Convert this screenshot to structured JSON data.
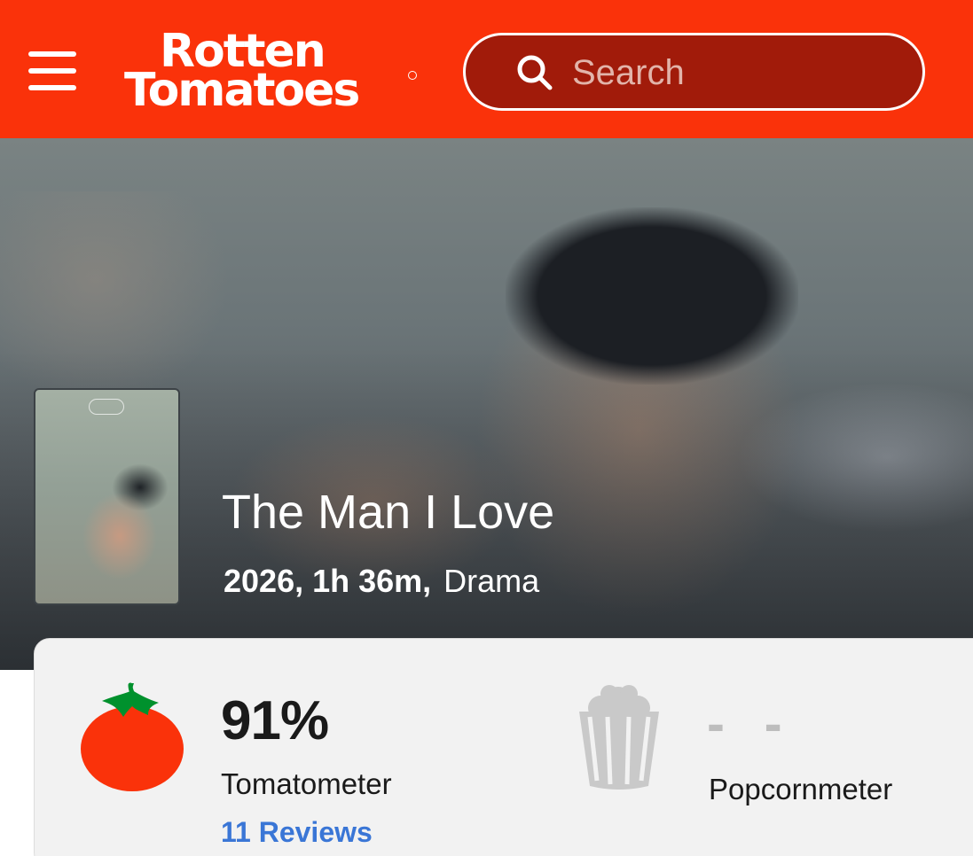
{
  "header": {
    "logo": {
      "line1": "Rotten",
      "line2": "Tomatoes"
    },
    "menu_icon": "hamburger-menu-icon",
    "search": {
      "placeholder": "Search",
      "icon": "search-icon"
    },
    "background_color": "#fa320a"
  },
  "movie": {
    "title": "The Man I Love",
    "year_runtime": "2026, 1h 36m,",
    "genre": "Drama"
  },
  "scores": {
    "tomatometer": {
      "value": "91%",
      "label": "Tomatometer",
      "reviews_link": "11 Reviews",
      "icon": "fresh-tomato-icon",
      "color": "#fa320a"
    },
    "popcornmeter": {
      "value": "- -",
      "label": "Popcornmeter",
      "icon": "empty-popcorn-icon"
    }
  },
  "colors": {
    "brand": "#fa320a",
    "link": "#3a76d6"
  }
}
